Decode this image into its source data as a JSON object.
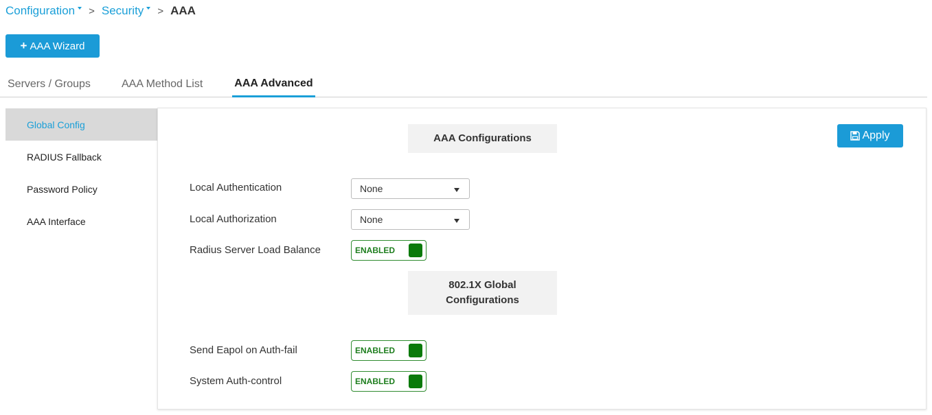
{
  "breadcrumb": {
    "configuration": "Configuration",
    "security": "Security",
    "separator": ">",
    "current": "AAA"
  },
  "wizard_button": {
    "icon": "plus-icon",
    "label": "AAA Wizard"
  },
  "tabs": [
    {
      "label": "Servers / Groups",
      "active": false
    },
    {
      "label": "AAA Method List",
      "active": false
    },
    {
      "label": "AAA Advanced",
      "active": true
    }
  ],
  "sidebar": {
    "items": [
      {
        "label": "Global Config",
        "active": true
      },
      {
        "label": "RADIUS Fallback",
        "active": false
      },
      {
        "label": "Password Policy",
        "active": false
      },
      {
        "label": "AAA Interface",
        "active": false
      }
    ]
  },
  "panel": {
    "aaa_header": "AAA Configurations",
    "dot1x_header_line1": "802.1X Global",
    "dot1x_header_line2": "Configurations",
    "apply_label": "Apply",
    "apply_icon": "save-icon",
    "fields": {
      "local_authentication": {
        "label": "Local Authentication",
        "value": "None"
      },
      "local_authorization": {
        "label": "Local Authorization",
        "value": "None"
      },
      "radius_load_balance": {
        "label": "Radius Server Load Balance",
        "state": "ENABLED"
      },
      "send_eapol": {
        "label": "Send Eapol on Auth-fail",
        "state": "ENABLED"
      },
      "system_auth_control": {
        "label": "System Auth-control",
        "state": "ENABLED"
      }
    }
  },
  "colors": {
    "accent": "#1a9fd8",
    "toggle_green": "#0a7a0a",
    "nav_active_bg": "#d9d9d9"
  }
}
